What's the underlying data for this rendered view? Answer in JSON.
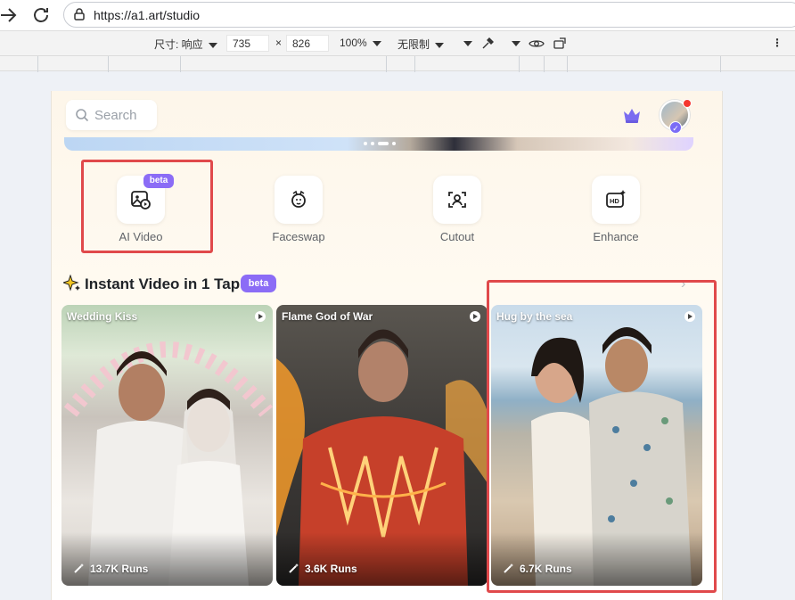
{
  "browser": {
    "url": "https://a1.art/studio"
  },
  "device_toolbar": {
    "size_label": "尺寸: 响应",
    "width": "735",
    "times": "×",
    "height": "826",
    "zoom": "100%",
    "throttle": "无限制"
  },
  "header": {
    "search_placeholder": "Search"
  },
  "tools": [
    {
      "label": "AI Video",
      "badge": "beta"
    },
    {
      "label": "Faceswap"
    },
    {
      "label": "Cutout"
    },
    {
      "label": "Enhance"
    }
  ],
  "section": {
    "title": "Instant Video in 1 Tap",
    "badge": "beta",
    "more": "›"
  },
  "cards": [
    {
      "title": "Wedding Kiss",
      "runs": "13.7K Runs"
    },
    {
      "title": "Flame God of War",
      "runs": "3.6K Runs"
    },
    {
      "title": "Hug by the sea",
      "runs": "6.7K Runs"
    }
  ],
  "colors": {
    "accent": "#8b6cf6",
    "highlight": "#e0494b"
  }
}
